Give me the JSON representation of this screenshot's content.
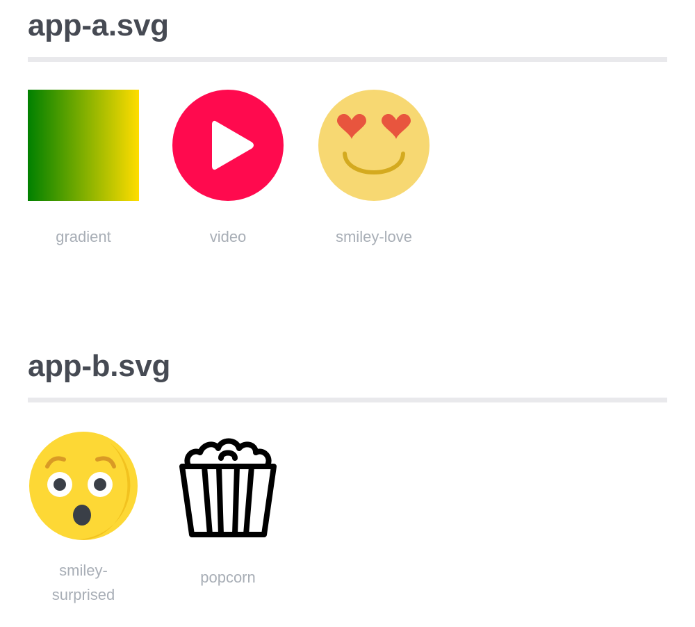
{
  "sections": [
    {
      "title": "app-a.svg",
      "icons": [
        {
          "label": "gradient",
          "icon": "gradient-icon"
        },
        {
          "label": "video",
          "icon": "video-play-icon"
        },
        {
          "label": "smiley-love",
          "icon": "smiley-love-icon"
        }
      ]
    },
    {
      "title": "app-b.svg",
      "icons": [
        {
          "label": "smiley-surprised",
          "icon": "smiley-surprised-icon"
        },
        {
          "label": "popcorn",
          "icon": "popcorn-icon"
        }
      ]
    }
  ],
  "colors": {
    "heading": "#464a53",
    "caption": "#a8aeb6",
    "divider": "#e9e9ec",
    "gradient_start": "#008000",
    "gradient_end": "#ffdd00",
    "video_red": "#ff0a4e",
    "love_face": "#f7d872",
    "love_heart": "#e8553e",
    "love_mouth": "#d4aa1f",
    "surprised_face": "#fdd835",
    "popcorn_stroke": "#000000"
  }
}
